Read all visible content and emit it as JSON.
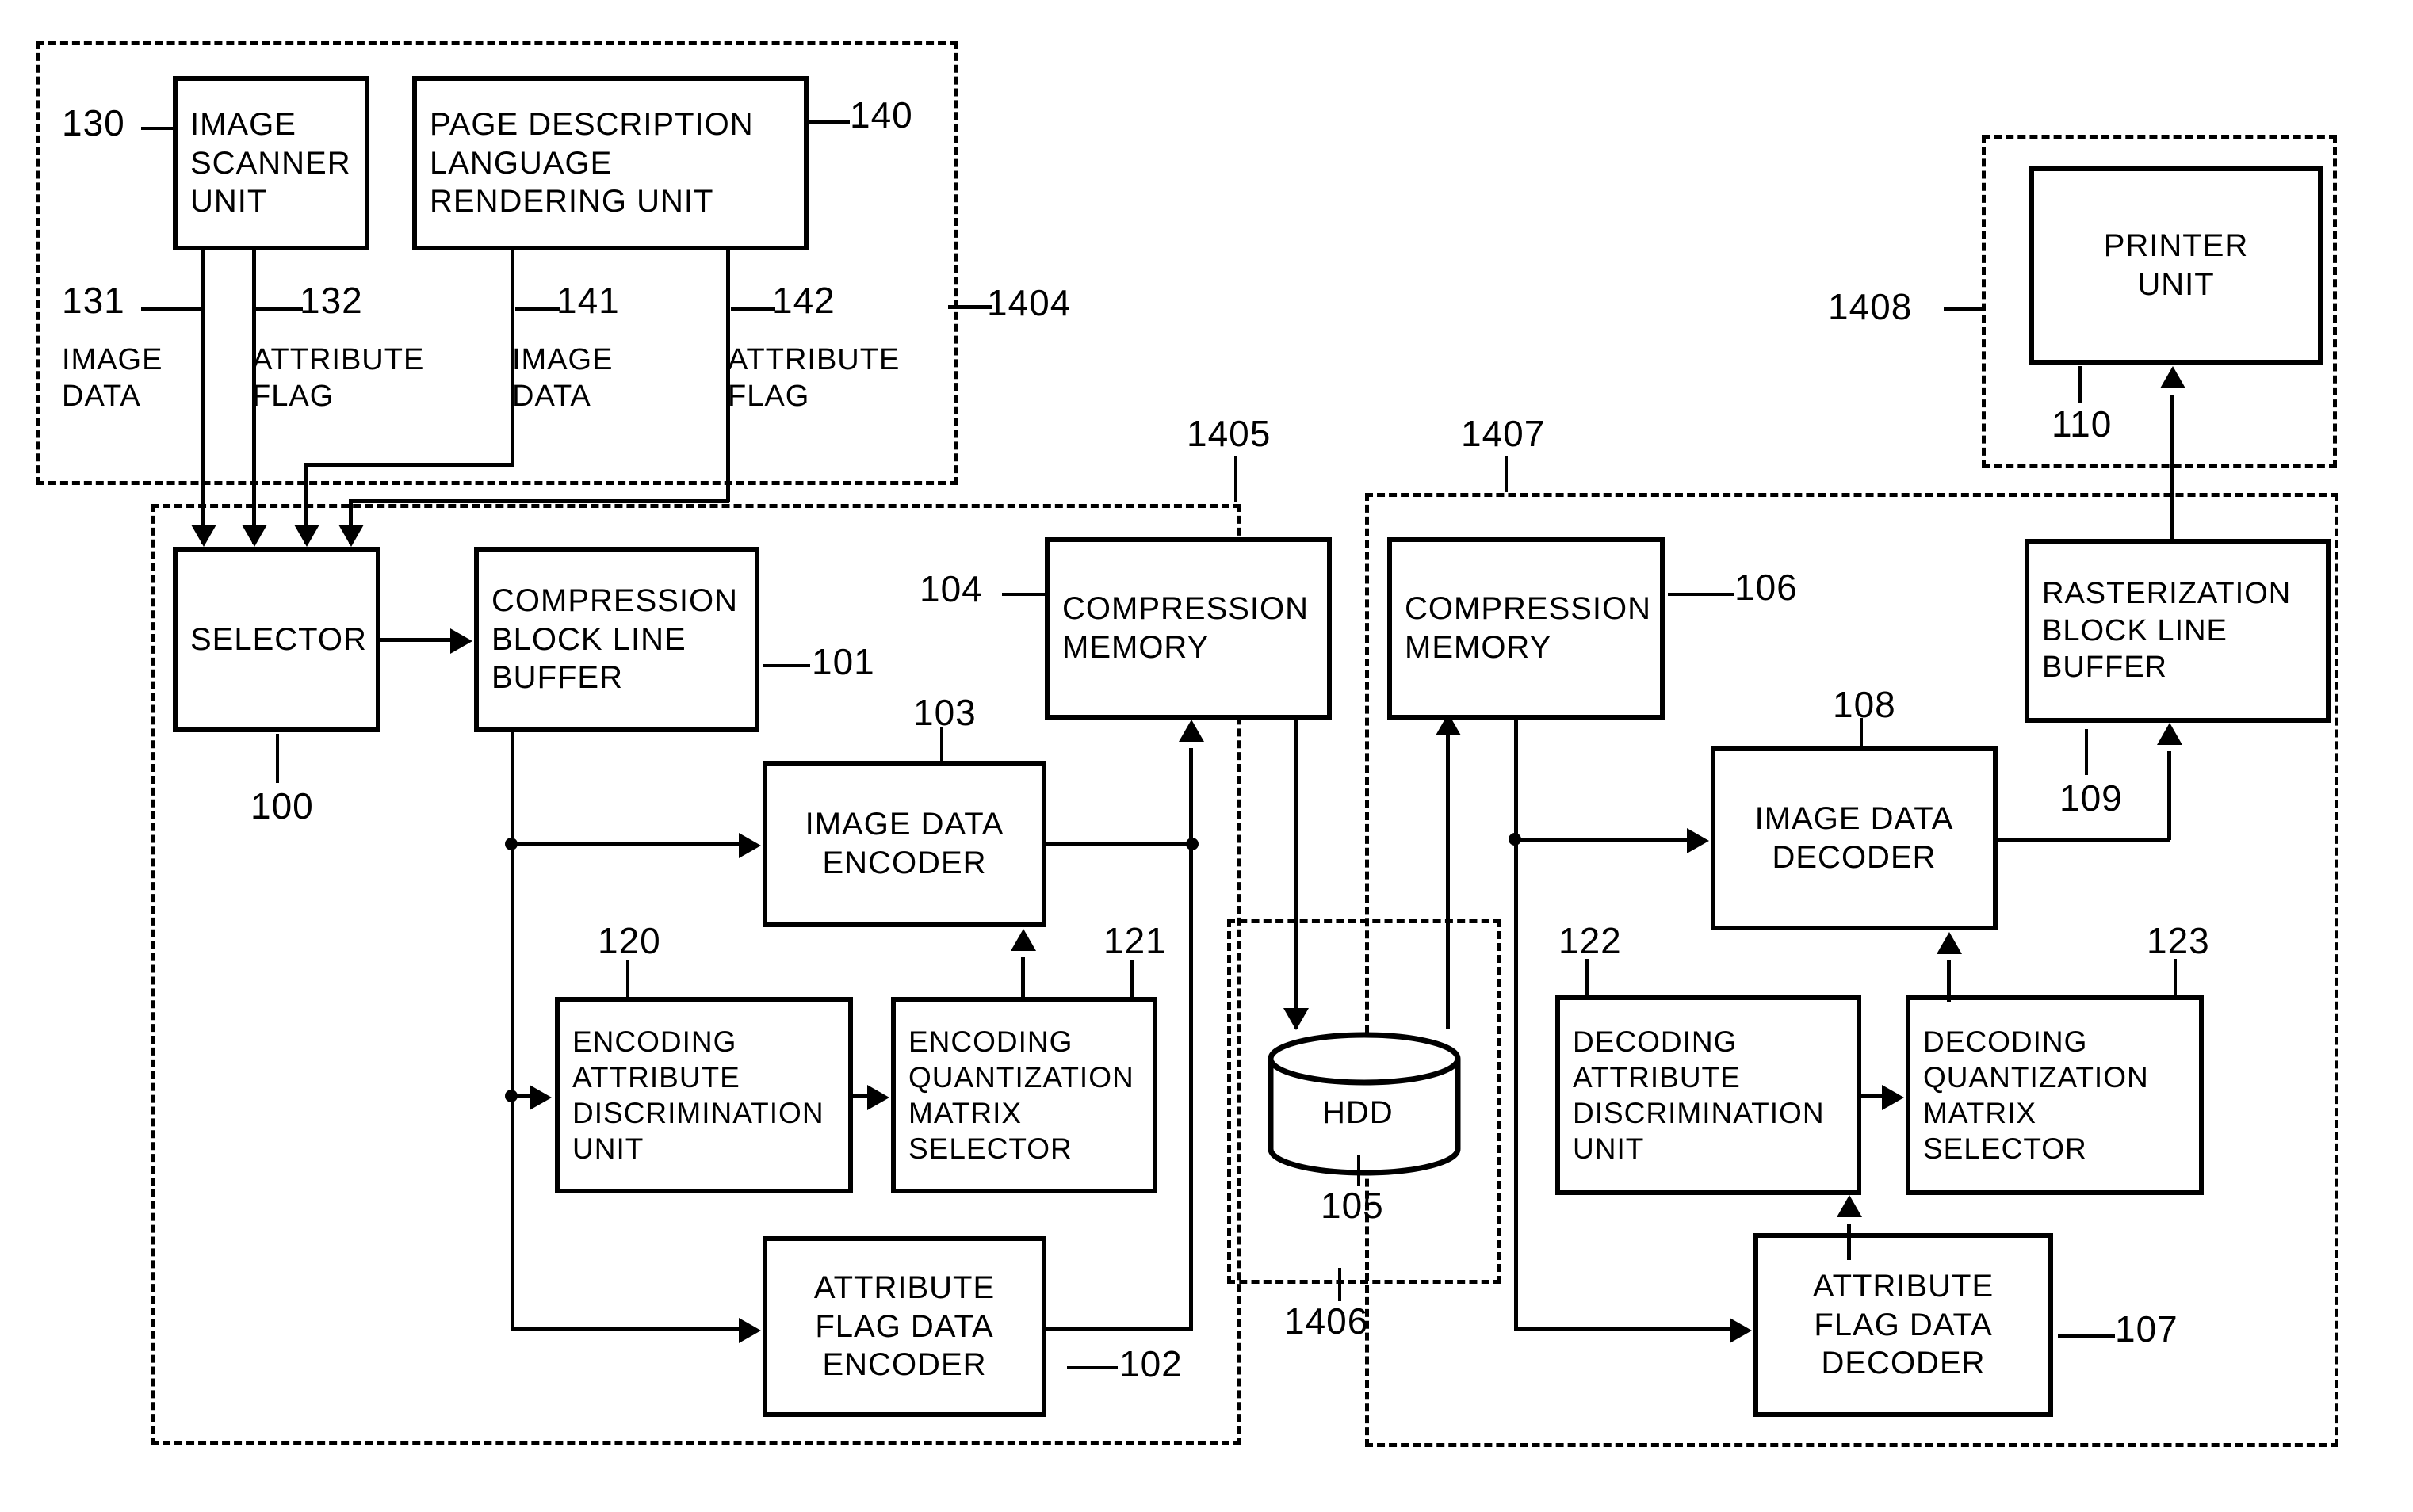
{
  "figure": {
    "type": "patent-block-diagram",
    "title": "Image compression/decompression block diagram"
  },
  "groups": [
    {
      "id": "1404",
      "label": "1404"
    },
    {
      "id": "1405",
      "label": "1405"
    },
    {
      "id": "1406",
      "label": "1406"
    },
    {
      "id": "1407",
      "label": "1407"
    },
    {
      "id": "1408",
      "label": "1408"
    }
  ],
  "blocks": {
    "image_scanner_unit": {
      "label": "IMAGE\nSCANNER\nUNIT",
      "ref": "130"
    },
    "pdl_rendering_unit": {
      "label": "PAGE DESCRIPTION\nLANGUAGE\nRENDERING UNIT",
      "ref": "140"
    },
    "printer_unit": {
      "label": "PRINTER\nUNIT",
      "ref": "110"
    },
    "selector": {
      "label": "SELECTOR",
      "ref": "100"
    },
    "compression_block_line_buffer": {
      "label": "COMPRESSION\nBLOCK LINE\nBUFFER",
      "ref": "101"
    },
    "image_data_encoder": {
      "label": "IMAGE DATA\nENCODER",
      "ref": "103"
    },
    "attribute_flag_data_encoder": {
      "label": "ATTRIBUTE\nFLAG DATA\nENCODER",
      "ref": "102"
    },
    "encoding_attribute_discrimination_unit": {
      "label": "ENCODING\nATTRIBUTE\nDISCRIMINATION\nUNIT",
      "ref": "120"
    },
    "encoding_quantization_matrix_selector": {
      "label": "ENCODING\nQUANTIZATION\nMATRIX\nSELECTOR",
      "ref": "121"
    },
    "compression_memory_left": {
      "label": "COMPRESSION\nMEMORY",
      "ref": "104"
    },
    "compression_memory_right": {
      "label": "COMPRESSION\nMEMORY",
      "ref": "106"
    },
    "hdd": {
      "label": "HDD",
      "ref": "105"
    },
    "image_data_decoder": {
      "label": "IMAGE DATA\nDECODER",
      "ref": "108"
    },
    "attribute_flag_data_decoder": {
      "label": "ATTRIBUTE\nFLAG DATA\nDECODER",
      "ref": "107"
    },
    "decoding_attribute_discrimination_unit": {
      "label": "DECODING\nATTRIBUTE\nDISCRIMINATION\nUNIT",
      "ref": "122"
    },
    "decoding_quantization_matrix_selector": {
      "label": "DECODING\nQUANTIZATION\nMATRIX\nSELECTOR",
      "ref": "123"
    },
    "rasterization_block_line_buffer": {
      "label": "RASTERIZATION\nBLOCK LINE\nBUFFER",
      "ref": "109"
    }
  },
  "signals": {
    "s131": {
      "ref": "131",
      "label": "IMAGE\nDATA"
    },
    "s132": {
      "ref": "132",
      "label": "ATTRIBUTE\nFLAG"
    },
    "s141": {
      "ref": "141",
      "label": "IMAGE\nDATA"
    },
    "s142": {
      "ref": "142",
      "label": "ATTRIBUTE\nFLAG"
    }
  }
}
